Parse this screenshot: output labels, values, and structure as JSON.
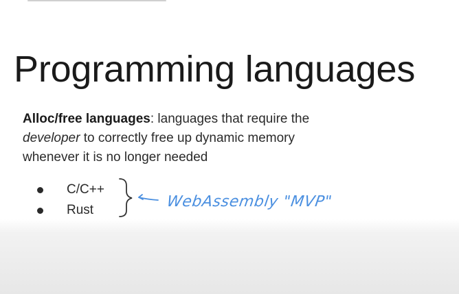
{
  "slide": {
    "title": "Programming languages",
    "definition": {
      "term": "Alloc/free languages",
      "colon": ":",
      "text_1": " languages that require the ",
      "emphasis": "developer",
      "text_2": " to correctly free up dynamic memory whenever it is no longer needed"
    },
    "bullets": [
      {
        "label": "C/C++"
      },
      {
        "label": "Rust"
      }
    ],
    "annotation": {
      "text": "WebAssembly \"MVP\"",
      "color": "#4a8fe0"
    }
  },
  "icons": {
    "bullet": "bullet-dot-icon",
    "brace": "curly-brace-icon",
    "arrow": "arrow-left-icon"
  }
}
